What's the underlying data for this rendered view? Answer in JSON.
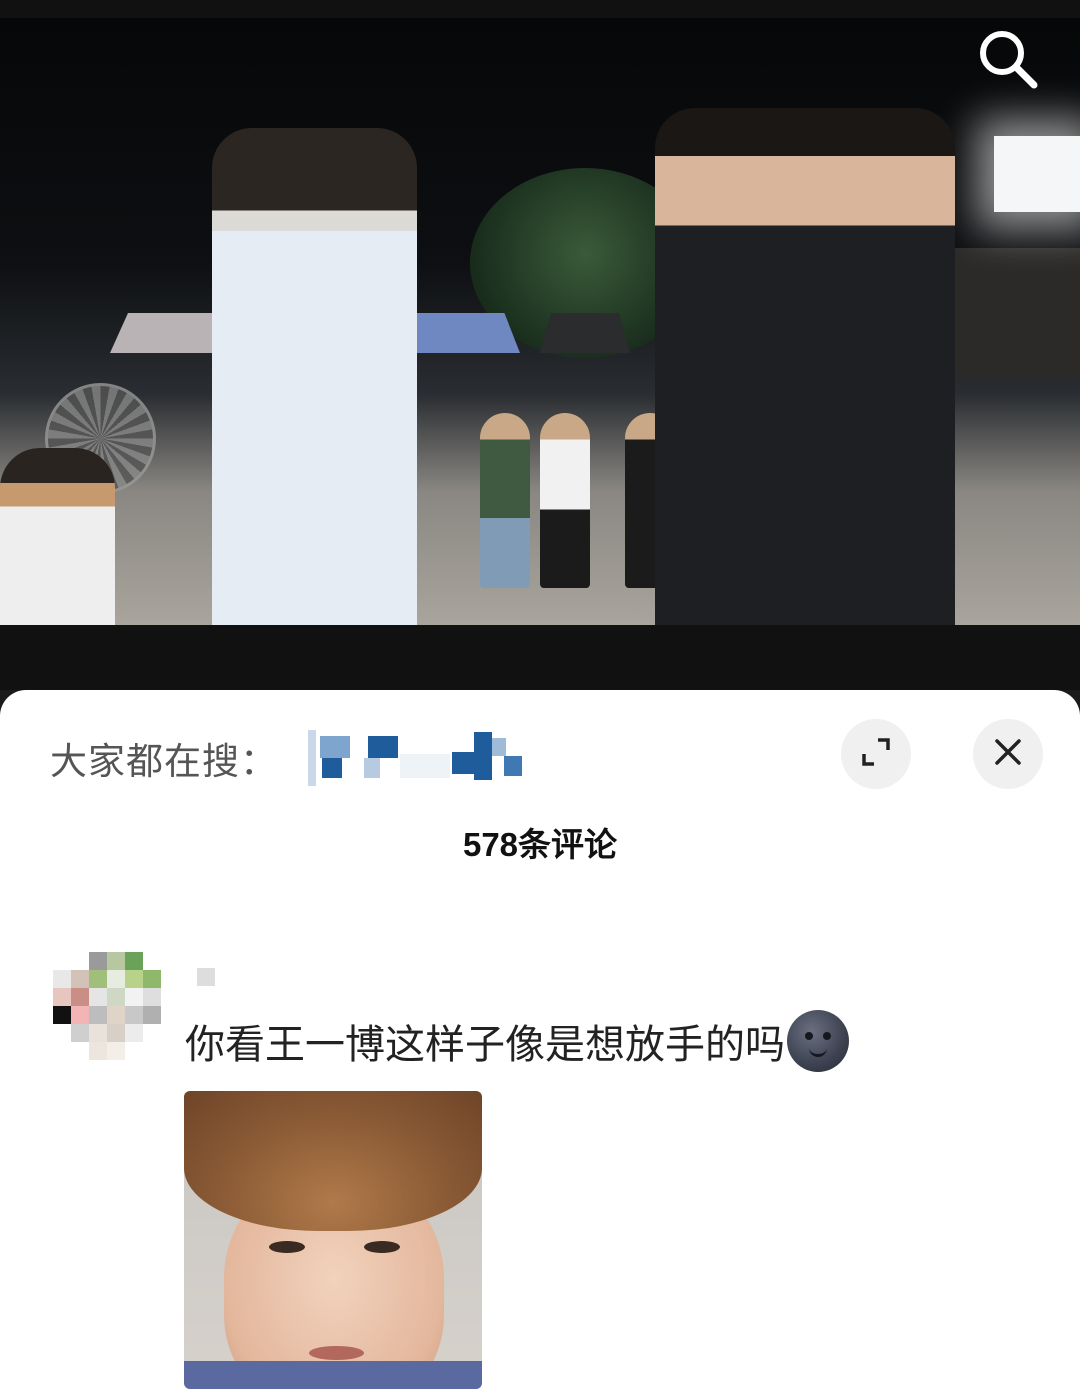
{
  "video": {
    "search_icon": "search-icon"
  },
  "sheet": {
    "trending_label": "大家都在搜：",
    "expand_icon": "expand-icon",
    "close_icon": "close-icon",
    "comment_count": "578条评论"
  },
  "comment": {
    "text": "你看王一博这样子像是想放手的吗",
    "emoji": "moon-face-icon",
    "sticker": "reaction-sticker"
  },
  "colors": {
    "sheet_bg": "#ffffff",
    "button_bg": "#f0f0f0",
    "text_primary": "#222222",
    "text_secondary": "#555555"
  }
}
